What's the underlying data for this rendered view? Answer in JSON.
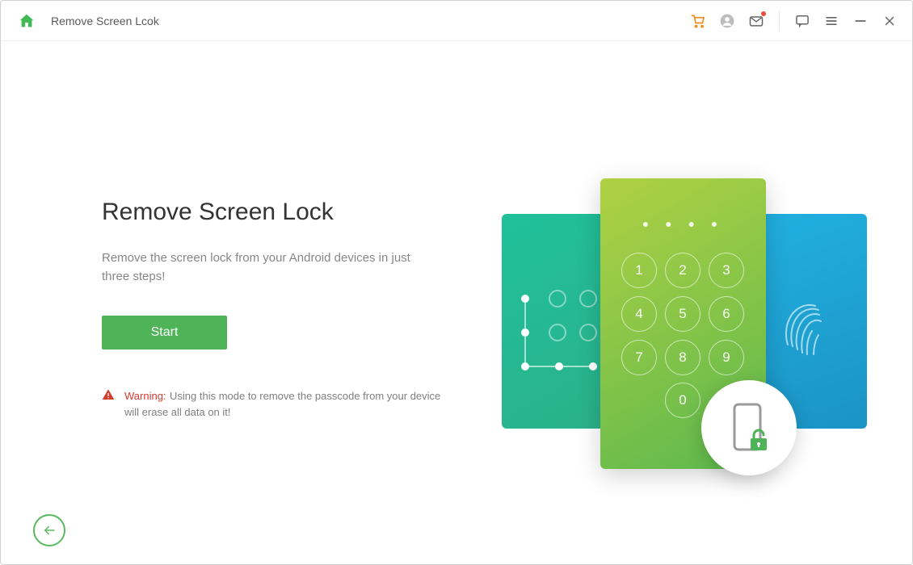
{
  "header": {
    "title": "Remove Screen Lcok"
  },
  "main": {
    "heading": "Remove Screen Lock",
    "subheading": "Remove the screen lock from your Android devices in just three steps!",
    "start_label": "Start",
    "warning_label": "Warning:",
    "warning_text": "Using this mode to remove the passcode from your device will erase all data on it!"
  },
  "keypad": {
    "keys": [
      "1",
      "2",
      "3",
      "4",
      "5",
      "6",
      "7",
      "8",
      "9",
      "0"
    ]
  },
  "colors": {
    "accent": "#4fb457",
    "warning": "#d53a2f",
    "cart": "#f58a1f"
  }
}
